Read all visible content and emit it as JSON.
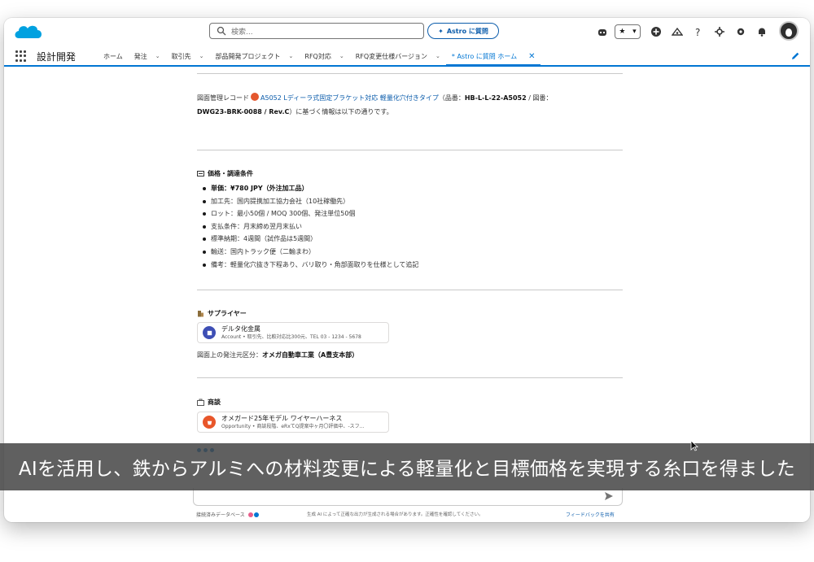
{
  "header": {
    "search_placeholder": "検索...",
    "astro_button": "Astro に質問"
  },
  "nav": {
    "app_name": "設計開発",
    "tabs": [
      {
        "label": "ホーム",
        "has_menu": false
      },
      {
        "label": "発注",
        "has_menu": true
      },
      {
        "label": "取引先",
        "has_menu": true
      },
      {
        "label": "部品開発プロジェクト",
        "has_menu": true
      },
      {
        "label": "RFQ対応",
        "has_menu": true
      },
      {
        "label": "RFQ変更仕様バージョン",
        "has_menu": true
      },
      {
        "label": "* Astro に質問 ホーム",
        "active": true
      }
    ]
  },
  "content": {
    "intro": {
      "prefix": "図面管理レコード",
      "record_link": "A5052 Lディーラ式固定ブラケット対応 軽量化穴付きタイプ",
      "part_label": "（品番：",
      "part_no": "HB-L-L-22-A5052",
      "drawing_label": " / 図番：",
      "drawing_no": "DWG23-BRK-0088 / Rev.C",
      "suffix": "）に基づく情報は以下の通りです。"
    },
    "price_section": {
      "title": "価格・調達条件",
      "items": [
        {
          "label": "単価：",
          "value": "¥780 JPY（外注加工品）"
        },
        {
          "label": "",
          "value": "加工先：国内提携加工協力会社（10社稼働先）"
        },
        {
          "label": "",
          "value": "ロット：最小50個 / MOQ 300個、発注単位50個"
        },
        {
          "label": "",
          "value": "支払条件：月末締め翌月末払い"
        },
        {
          "label": "",
          "value": "標準納期：4週間（試作品は5週間）"
        },
        {
          "label": "",
          "value": "輸送：国内トラック便（二輸まわ）"
        },
        {
          "label": "",
          "value": "備考：軽量化穴抜き下程あり、バリ取り・角部面取りを仕様として追記"
        }
      ]
    },
    "supplier_section": {
      "title": "サプライヤー",
      "card_title": "デルタ化金属",
      "card_sub": "Account • 取引先、比較対応比300元、TEL 03 - 1234 - 5678",
      "issuer_label": "図面上の発注元区分：",
      "issuer_value": "オメガ自動車工業（A豊支本部）"
    },
    "opportunity_section": {
      "title": "商談",
      "card_title": "オメガード25年モデル ワイヤーハーネス",
      "card_sub": "Opportunity • 商談段階、eRxてQ提案中ヶ月〇評価中、-スフ..."
    }
  },
  "footer": {
    "left": "接続済みデータベース",
    "middle": "生成 AI によって正確な出力が生成される場合があります。正確性を確認してください。",
    "right": "フィードバックを共有"
  },
  "caption": {
    "text": "AIを活用し、鉄からアルミへの材料変更による軽量化と目標価格を実現する糸口を得ました"
  },
  "colors": {
    "brand": "#00a1e0",
    "accent": "#0176d3",
    "caption_bg": "#464646"
  },
  "icons": [
    "salesforce-logo",
    "search-icon",
    "sparkle-icon",
    "star-icon",
    "add-icon",
    "help-icon",
    "setup-icon",
    "bell-icon",
    "edit-icon",
    "send-icon"
  ]
}
